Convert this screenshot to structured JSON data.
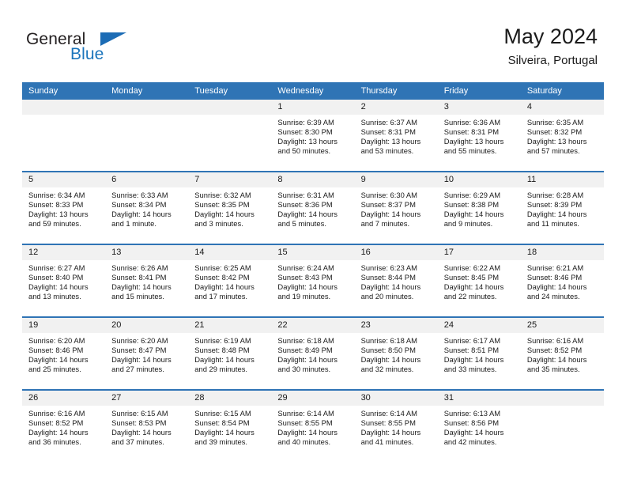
{
  "logo": {
    "word1": "General",
    "word2": "Blue",
    "triangle_color": "#1c6cb5"
  },
  "header": {
    "title": "May 2024",
    "subtitle": "Silveira, Portugal",
    "accent_color": "#2f74b5"
  },
  "weekday_headers": [
    "Sunday",
    "Monday",
    "Tuesday",
    "Wednesday",
    "Thursday",
    "Friday",
    "Saturday"
  ],
  "labels": {
    "sunrise": "Sunrise:",
    "sunset": "Sunset:",
    "daylight": "Daylight:"
  },
  "weeks": [
    [
      {
        "day": "",
        "empty": true
      },
      {
        "day": "",
        "empty": true
      },
      {
        "day": "",
        "empty": true
      },
      {
        "day": "1",
        "sunrise": "Sunrise: 6:39 AM",
        "sunset": "Sunset: 8:30 PM",
        "daylight1": "Daylight: 13 hours",
        "daylight2": "and 50 minutes."
      },
      {
        "day": "2",
        "sunrise": "Sunrise: 6:37 AM",
        "sunset": "Sunset: 8:31 PM",
        "daylight1": "Daylight: 13 hours",
        "daylight2": "and 53 minutes."
      },
      {
        "day": "3",
        "sunrise": "Sunrise: 6:36 AM",
        "sunset": "Sunset: 8:31 PM",
        "daylight1": "Daylight: 13 hours",
        "daylight2": "and 55 minutes."
      },
      {
        "day": "4",
        "sunrise": "Sunrise: 6:35 AM",
        "sunset": "Sunset: 8:32 PM",
        "daylight1": "Daylight: 13 hours",
        "daylight2": "and 57 minutes."
      }
    ],
    [
      {
        "day": "5",
        "sunrise": "Sunrise: 6:34 AM",
        "sunset": "Sunset: 8:33 PM",
        "daylight1": "Daylight: 13 hours",
        "daylight2": "and 59 minutes."
      },
      {
        "day": "6",
        "sunrise": "Sunrise: 6:33 AM",
        "sunset": "Sunset: 8:34 PM",
        "daylight1": "Daylight: 14 hours",
        "daylight2": "and 1 minute."
      },
      {
        "day": "7",
        "sunrise": "Sunrise: 6:32 AM",
        "sunset": "Sunset: 8:35 PM",
        "daylight1": "Daylight: 14 hours",
        "daylight2": "and 3 minutes."
      },
      {
        "day": "8",
        "sunrise": "Sunrise: 6:31 AM",
        "sunset": "Sunset: 8:36 PM",
        "daylight1": "Daylight: 14 hours",
        "daylight2": "and 5 minutes."
      },
      {
        "day": "9",
        "sunrise": "Sunrise: 6:30 AM",
        "sunset": "Sunset: 8:37 PM",
        "daylight1": "Daylight: 14 hours",
        "daylight2": "and 7 minutes."
      },
      {
        "day": "10",
        "sunrise": "Sunrise: 6:29 AM",
        "sunset": "Sunset: 8:38 PM",
        "daylight1": "Daylight: 14 hours",
        "daylight2": "and 9 minutes."
      },
      {
        "day": "11",
        "sunrise": "Sunrise: 6:28 AM",
        "sunset": "Sunset: 8:39 PM",
        "daylight1": "Daylight: 14 hours",
        "daylight2": "and 11 minutes."
      }
    ],
    [
      {
        "day": "12",
        "sunrise": "Sunrise: 6:27 AM",
        "sunset": "Sunset: 8:40 PM",
        "daylight1": "Daylight: 14 hours",
        "daylight2": "and 13 minutes."
      },
      {
        "day": "13",
        "sunrise": "Sunrise: 6:26 AM",
        "sunset": "Sunset: 8:41 PM",
        "daylight1": "Daylight: 14 hours",
        "daylight2": "and 15 minutes."
      },
      {
        "day": "14",
        "sunrise": "Sunrise: 6:25 AM",
        "sunset": "Sunset: 8:42 PM",
        "daylight1": "Daylight: 14 hours",
        "daylight2": "and 17 minutes."
      },
      {
        "day": "15",
        "sunrise": "Sunrise: 6:24 AM",
        "sunset": "Sunset: 8:43 PM",
        "daylight1": "Daylight: 14 hours",
        "daylight2": "and 19 minutes."
      },
      {
        "day": "16",
        "sunrise": "Sunrise: 6:23 AM",
        "sunset": "Sunset: 8:44 PM",
        "daylight1": "Daylight: 14 hours",
        "daylight2": "and 20 minutes."
      },
      {
        "day": "17",
        "sunrise": "Sunrise: 6:22 AM",
        "sunset": "Sunset: 8:45 PM",
        "daylight1": "Daylight: 14 hours",
        "daylight2": "and 22 minutes."
      },
      {
        "day": "18",
        "sunrise": "Sunrise: 6:21 AM",
        "sunset": "Sunset: 8:46 PM",
        "daylight1": "Daylight: 14 hours",
        "daylight2": "and 24 minutes."
      }
    ],
    [
      {
        "day": "19",
        "sunrise": "Sunrise: 6:20 AM",
        "sunset": "Sunset: 8:46 PM",
        "daylight1": "Daylight: 14 hours",
        "daylight2": "and 25 minutes."
      },
      {
        "day": "20",
        "sunrise": "Sunrise: 6:20 AM",
        "sunset": "Sunset: 8:47 PM",
        "daylight1": "Daylight: 14 hours",
        "daylight2": "and 27 minutes."
      },
      {
        "day": "21",
        "sunrise": "Sunrise: 6:19 AM",
        "sunset": "Sunset: 8:48 PM",
        "daylight1": "Daylight: 14 hours",
        "daylight2": "and 29 minutes."
      },
      {
        "day": "22",
        "sunrise": "Sunrise: 6:18 AM",
        "sunset": "Sunset: 8:49 PM",
        "daylight1": "Daylight: 14 hours",
        "daylight2": "and 30 minutes."
      },
      {
        "day": "23",
        "sunrise": "Sunrise: 6:18 AM",
        "sunset": "Sunset: 8:50 PM",
        "daylight1": "Daylight: 14 hours",
        "daylight2": "and 32 minutes."
      },
      {
        "day": "24",
        "sunrise": "Sunrise: 6:17 AM",
        "sunset": "Sunset: 8:51 PM",
        "daylight1": "Daylight: 14 hours",
        "daylight2": "and 33 minutes."
      },
      {
        "day": "25",
        "sunrise": "Sunrise: 6:16 AM",
        "sunset": "Sunset: 8:52 PM",
        "daylight1": "Daylight: 14 hours",
        "daylight2": "and 35 minutes."
      }
    ],
    [
      {
        "day": "26",
        "sunrise": "Sunrise: 6:16 AM",
        "sunset": "Sunset: 8:52 PM",
        "daylight1": "Daylight: 14 hours",
        "daylight2": "and 36 minutes."
      },
      {
        "day": "27",
        "sunrise": "Sunrise: 6:15 AM",
        "sunset": "Sunset: 8:53 PM",
        "daylight1": "Daylight: 14 hours",
        "daylight2": "and 37 minutes."
      },
      {
        "day": "28",
        "sunrise": "Sunrise: 6:15 AM",
        "sunset": "Sunset: 8:54 PM",
        "daylight1": "Daylight: 14 hours",
        "daylight2": "and 39 minutes."
      },
      {
        "day": "29",
        "sunrise": "Sunrise: 6:14 AM",
        "sunset": "Sunset: 8:55 PM",
        "daylight1": "Daylight: 14 hours",
        "daylight2": "and 40 minutes."
      },
      {
        "day": "30",
        "sunrise": "Sunrise: 6:14 AM",
        "sunset": "Sunset: 8:55 PM",
        "daylight1": "Daylight: 14 hours",
        "daylight2": "and 41 minutes."
      },
      {
        "day": "31",
        "sunrise": "Sunrise: 6:13 AM",
        "sunset": "Sunset: 8:56 PM",
        "daylight1": "Daylight: 14 hours",
        "daylight2": "and 42 minutes."
      },
      {
        "day": "",
        "empty": true
      }
    ]
  ]
}
